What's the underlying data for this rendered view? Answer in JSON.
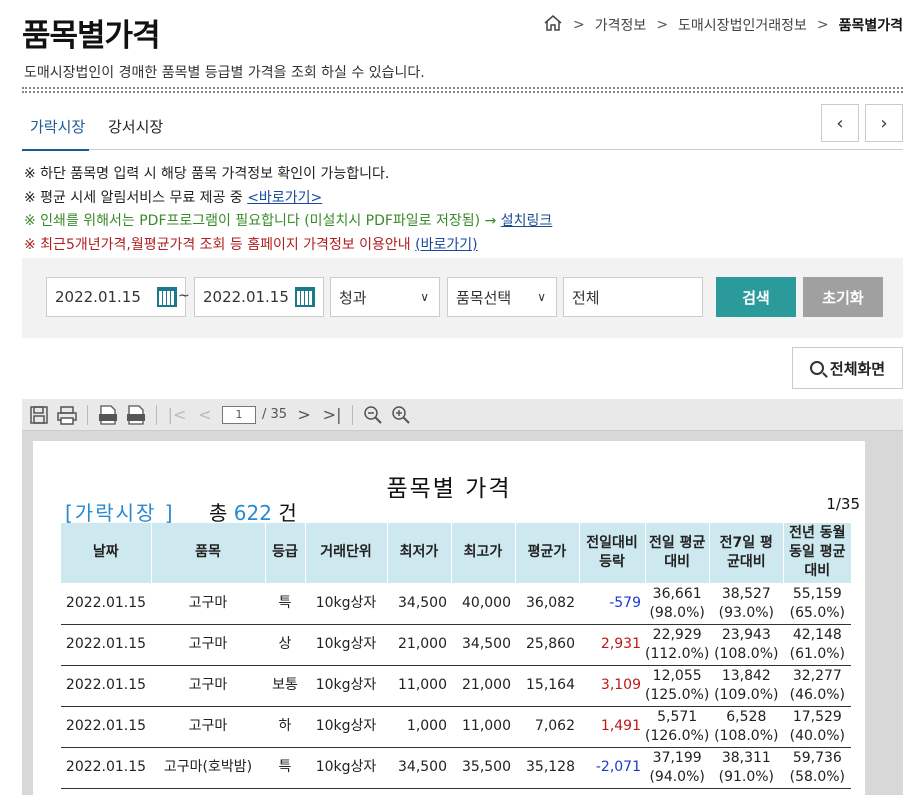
{
  "page": {
    "title": "품목별가격",
    "description": "도매시장법인이 경매한 품목별 등급별 가격을 조회 하실 수 있습니다.",
    "breadcrumb": [
      "가격정보",
      "도매시장법인거래정보",
      "품목별가격"
    ]
  },
  "tabs": [
    "가락시장",
    "강서시장"
  ],
  "notes": {
    "n1": "※ 하단 품목명 입력 시 해당 품목 가격정보 확인이 가능합니다.",
    "n2": "※ 평균 시세 알림서비스 무료 제공 중 ",
    "n2_link": "<바로가기>",
    "n3": "※ 인쇄를 위해서는 PDF프로그램이 필요합니다 (미설치시 PDF파일로 저장됨) → ",
    "n3_link": "설치링크",
    "n4": "※ 최근5개년가격,월평균가격 조회 등 홈페이지 가격정보 이용안내 ",
    "n4_link": "(바로가기)"
  },
  "search": {
    "date_from": "2022.01.15",
    "date_to": "2022.01.15",
    "tilde": "~",
    "category": "청과",
    "item_select": "품목선택",
    "keyword": "전체",
    "search_label": "검색",
    "reset_label": "초기화",
    "fullscreen_label": "전체화면"
  },
  "viewer": {
    "page_current": "1",
    "page_total": "/ 35"
  },
  "report": {
    "title": "품목별 가격",
    "market": "[가락시장 ]",
    "total_prefix": "총",
    "total_count": "622",
    "total_suffix": "건",
    "page": "1/35",
    "headers": [
      "날짜",
      "품목",
      "등급",
      "거래단위",
      "최저가",
      "최고가",
      "평균가",
      "전일대비 등락",
      "전일 평균대비",
      "전7일 평균대비",
      "전년 동월동일 평균대비"
    ],
    "rows": [
      {
        "date": "2022.01.15",
        "item": "고구마",
        "grade": "특",
        "unit": "10kg상자",
        "min": "34,500",
        "max": "40,000",
        "avg": "36,082",
        "diff": "-579",
        "prev1": "36,661",
        "prev1p": "(98.0%)",
        "prev7": "38,527",
        "prev7p": "(93.0%)",
        "prevy": "55,159",
        "prevyp": "(65.0%)",
        "dir": "down"
      },
      {
        "date": "2022.01.15",
        "item": "고구마",
        "grade": "상",
        "unit": "10kg상자",
        "min": "21,000",
        "max": "34,500",
        "avg": "25,860",
        "diff": "2,931",
        "prev1": "22,929",
        "prev1p": "(112.0%)",
        "prev7": "23,943",
        "prev7p": "(108.0%)",
        "prevy": "42,148",
        "prevyp": "(61.0%)",
        "dir": "up"
      },
      {
        "date": "2022.01.15",
        "item": "고구마",
        "grade": "보통",
        "unit": "10kg상자",
        "min": "11,000",
        "max": "21,000",
        "avg": "15,164",
        "diff": "3,109",
        "prev1": "12,055",
        "prev1p": "(125.0%)",
        "prev7": "13,842",
        "prev7p": "(109.0%)",
        "prevy": "32,277",
        "prevyp": "(46.0%)",
        "dir": "up"
      },
      {
        "date": "2022.01.15",
        "item": "고구마",
        "grade": "하",
        "unit": "10kg상자",
        "min": "1,000",
        "max": "11,000",
        "avg": "7,062",
        "diff": "1,491",
        "prev1": "5,571",
        "prev1p": "(126.0%)",
        "prev7": "6,528",
        "prev7p": "(108.0%)",
        "prevy": "17,529",
        "prevyp": "(40.0%)",
        "dir": "up"
      },
      {
        "date": "2022.01.15",
        "item": "고구마(호박밤)",
        "grade": "특",
        "unit": "10kg상자",
        "min": "34,500",
        "max": "35,500",
        "avg": "35,128",
        "diff": "-2,071",
        "prev1": "37,199",
        "prev1p": "(94.0%)",
        "prev7": "38,311",
        "prev7p": "(91.0%)",
        "prevy": "59,736",
        "prevyp": "(58.0%)",
        "dir": "down"
      }
    ]
  }
}
